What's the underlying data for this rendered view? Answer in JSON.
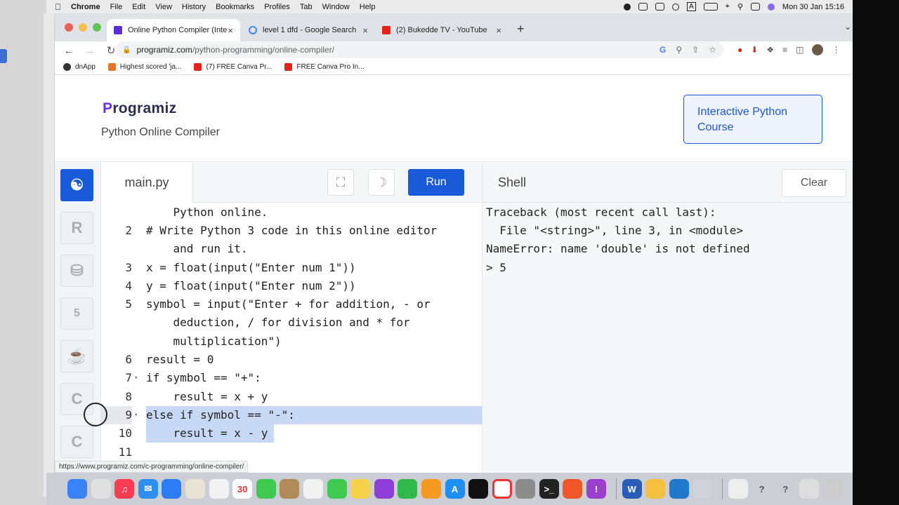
{
  "menubar": {
    "app": "Chrome",
    "items": [
      "File",
      "Edit",
      "View",
      "History",
      "Bookmarks",
      "Profiles",
      "Tab",
      "Window",
      "Help"
    ],
    "clock": "Mon 30 Jan  15:16"
  },
  "tabs": [
    {
      "label": "Online Python Compiler (Interpr",
      "favicon": "#5b2fd1"
    },
    {
      "label": "level 1 dfd - Google Search",
      "favicon": "#4285f4"
    },
    {
      "label": "(2) Bukedde TV - YouTube",
      "favicon": "#e62117"
    }
  ],
  "address": {
    "host": "programiz.com",
    "path": "/python-programming/online-compiler/"
  },
  "bookmarks": [
    {
      "label": "dnApp",
      "color": "#333"
    },
    {
      "label": "Highest scored 'ja...",
      "color": "#e8742a"
    },
    {
      "label": "(7) FREE Canva Pr...",
      "color": "#e62117"
    },
    {
      "label": "FREE Canva Pro In...",
      "color": "#e62117"
    }
  ],
  "site": {
    "logo_rest": "rogramiz",
    "subtitle": "Python Online Compiler",
    "course_button": "Interactive Python Course"
  },
  "editor": {
    "file_tab": "main.py",
    "run_label": "Run",
    "lines": [
      {
        "num": "",
        "text": "    Python online."
      },
      {
        "num": "2",
        "text": "# Write Python 3 code in this online editor"
      },
      {
        "num": "",
        "text": "    and run it."
      },
      {
        "num": "3",
        "text": "x = float(input(\"Enter num 1\"))"
      },
      {
        "num": "4",
        "text": "y = float(input(\"Enter num 2\"))"
      },
      {
        "num": "5",
        "text": "symbol = input(\"Enter + for addition, - or"
      },
      {
        "num": "",
        "text": "    deduction, / for division and * for"
      },
      {
        "num": "",
        "text": "    multiplication\")"
      },
      {
        "num": "6",
        "text": "result = 0"
      },
      {
        "num": "7",
        "text": "if symbol == \"+\":"
      },
      {
        "num": "8",
        "text": "    result = x + y"
      },
      {
        "num": "9",
        "text": "else if symbol == \"-\":"
      },
      {
        "num": "10",
        "text": "    result = x - y"
      },
      {
        "num": "11",
        "text": ""
      }
    ]
  },
  "shell": {
    "title": "Shell",
    "clear_label": "Clear",
    "lines": [
      "Traceback (most recent call last):",
      "  File \"<string>\", line 3, in <module>",
      "NameError: name 'double' is not defined",
      "> 5"
    ]
  },
  "status_url": "https://www.programiz.com/c-programming/online-compiler/",
  "colors": {
    "brand": "#6b33e0",
    "accent": "#1a5ad8",
    "selection": "#c8d9f5"
  }
}
